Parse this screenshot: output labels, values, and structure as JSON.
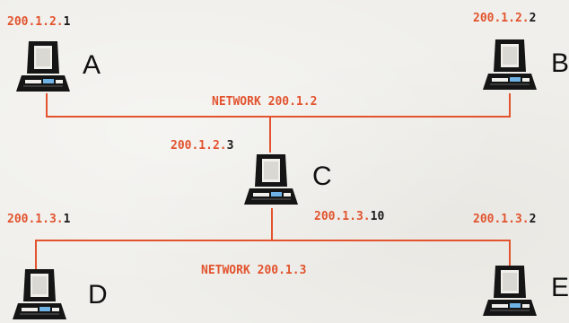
{
  "colors": {
    "address_prefix": "#e2532e",
    "address_host": "#1a1a1a",
    "network_line": "#e2532e",
    "network_label": "#e2532e",
    "computer": "#151515",
    "screen_accent": "#6fb3e6"
  },
  "networks": [
    {
      "id": "net1",
      "label": "NETWORK 200.1.2"
    },
    {
      "id": "net2",
      "label": "NETWORK 200.1.3"
    }
  ],
  "nodes": {
    "A": {
      "letter": "A",
      "icon": "computer-icon",
      "address": {
        "prefix": "200.1.2.",
        "host": "1"
      }
    },
    "B": {
      "letter": "B",
      "icon": "computer-icon",
      "address": {
        "prefix": "200.1.2.",
        "host": "2"
      }
    },
    "C": {
      "letter": "C",
      "icon": "computer-icon",
      "address_net1": {
        "prefix": "200.1.2.",
        "host": "3"
      },
      "address_net2": {
        "prefix": "200.1.3.",
        "host": "10"
      }
    },
    "D": {
      "letter": "D",
      "icon": "computer-icon",
      "address": {
        "prefix": "200.1.3.",
        "host": "1"
      }
    },
    "E": {
      "letter": "E",
      "icon": "computer-icon",
      "address": {
        "prefix": "200.1.3.",
        "host": "2"
      }
    }
  }
}
